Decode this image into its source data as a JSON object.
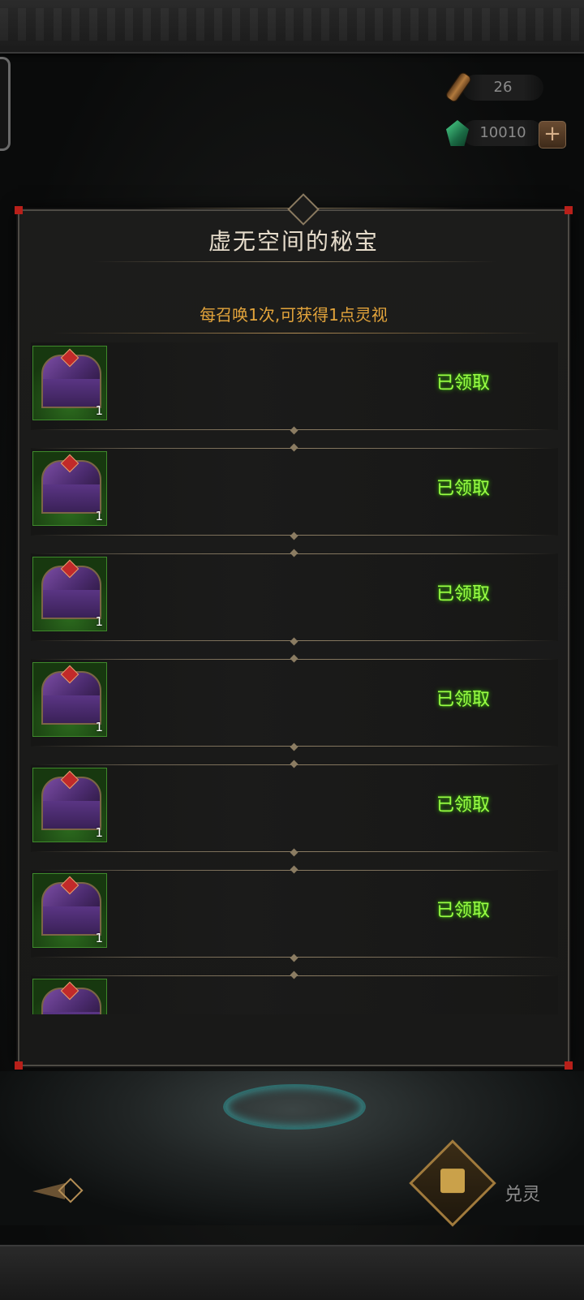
{
  "currencies": {
    "scroll_count": "26",
    "gem_count": "10010"
  },
  "panel": {
    "title": "虚无空间的秘宝",
    "subtitle": "每召唤1次,可获得1点灵视"
  },
  "rewards": [
    {
      "quantity": "1",
      "status": "已领取"
    },
    {
      "quantity": "1",
      "status": "已领取"
    },
    {
      "quantity": "1",
      "status": "已领取"
    },
    {
      "quantity": "1",
      "status": "已领取"
    },
    {
      "quantity": "1",
      "status": "已领取"
    },
    {
      "quantity": "1",
      "status": "已领取"
    },
    {
      "quantity": "",
      "status": ""
    }
  ],
  "bottom": {
    "exchange_label": "兑灵"
  },
  "colors": {
    "status_green": "#9bff45",
    "subtitle_orange": "#e3a43b",
    "title": "#e6dccb"
  }
}
